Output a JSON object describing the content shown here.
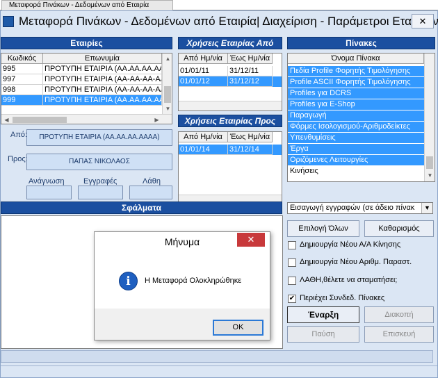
{
  "tab": {
    "label": "Μεταφορά Πινάκων - Δεδομένων από Εταιρία"
  },
  "window": {
    "title": "Μεταφορά Πινάκων - Δεδομένων από Εταιρία| Διαχείριση - Παράμετροι Εταιριών",
    "close_glyph": "✕"
  },
  "companies": {
    "header": "Εταιρίες",
    "columns": [
      "Κωδικός",
      "Επωνυμία"
    ],
    "rows": [
      {
        "code": "995",
        "name": "ΠΡΟΤΥΠΗ ΕΤΑΙΡΙΑ (ΑΑ.ΑΑ.ΑΑ.ΑΑΑΑ)"
      },
      {
        "code": "997",
        "name": "ΠΡΟΤΥΠΗ ΕΤΑΙΡΙΑ (ΑΑ-ΑΑ-ΑΑ-ΑΑΑΑ)"
      },
      {
        "code": "998",
        "name": "ΠΡΟΤΥΠΗ ΕΤΑΙΡΙΑ (ΑΑ-ΑΑ-ΑΑ-ΑΑΑΑ)"
      },
      {
        "code": "999",
        "name": "ΠΡΟΤΥΠΗ ΕΤΑΙΡΙΑ (ΑΑ.ΑΑ.ΑΑ.ΑΑΑΑ)"
      }
    ],
    "selected_index": 3
  },
  "years_from": {
    "header": "Χρήσεις Εταιρίας Από",
    "columns": [
      "Από Ημ/νία",
      "Έως Ημ/νία"
    ],
    "rows": [
      {
        "from": "01/01/11",
        "to": "31/12/11"
      },
      {
        "from": "01/01/12",
        "to": "31/12/12"
      }
    ],
    "selected_index": 1
  },
  "years_to": {
    "header": "Χρήσεις Εταιρίας Προς",
    "columns": [
      "Από Ημ/νία",
      "Έως Ημ/νία"
    ],
    "rows": [
      {
        "from": "01/01/14",
        "to": "31/12/14"
      }
    ],
    "selected_index": 0
  },
  "tables": {
    "header": "Πίνακες",
    "column": "Όνομα Πίνακα",
    "rows": [
      "Πεδία Profile Φορητής Τιμολόγησης",
      "Profile ASCII Φορητής Τιμολόγησης",
      "Profiles για DCRS",
      "Profiles για E-Shop",
      "Παραγωγή",
      "Φόρμες Ισολογισμού-Αριθμοδείκτες",
      "Υπενθυμίσεις",
      "Έργα",
      "Οριζόμενες Λειτουργίες",
      "Κινήσεις"
    ],
    "selected_count": 9
  },
  "transfer": {
    "from_label": "Από:",
    "from_value": "ΠΡΟΤΥΠΗ ΕΤΑΙΡΙΑ (ΑΑ.ΑΑ.ΑΑ.ΑΑΑΑ)",
    "to_label": "Προς:",
    "to_value": "ΠΑΠΑΣ ΝΙΚΟΛΑΟΣ",
    "reads_label": "Ανάγνωση",
    "records_label": "Εγγραφές",
    "errors_label": "Λάθη",
    "reads_value": "",
    "records_value": "",
    "errors_value": ""
  },
  "errors_panel": {
    "header": "Σφάλματα"
  },
  "controls": {
    "mode_select": "Εισαγωγή εγγραφών (σε άδειο πίνακ",
    "select_all": "Επιλογή Όλων",
    "clear": "Καθαρισμός",
    "checkboxes": [
      {
        "label": "Δημιουργία Νέου Α/Α Κίνησης",
        "checked": false
      },
      {
        "label": "Δημιουργία Νέου Αριθμ. Παραστ.",
        "checked": false
      },
      {
        "label": "ΛΑΘΗ,θέλετε να σταματήσει;",
        "checked": false
      },
      {
        "label": "Περιέχει Συνδεδ. Πίνακες",
        "checked": true
      }
    ],
    "check_glyph": "✔",
    "start": "Έναρξη",
    "stop": "Διακοπή",
    "pause": "Παύση",
    "resume": "Επισκευή"
  },
  "dialog": {
    "title": "Μήνυμα",
    "message": "Η Μεταφορά Ολοκληρώθηκε",
    "ok": "OK",
    "close_glyph": "✕",
    "icon_glyph": "i"
  },
  "colors": {
    "panel_header": "#1b4fa0",
    "selection": "#3399ff",
    "window_bg": "#dbe6f4"
  }
}
